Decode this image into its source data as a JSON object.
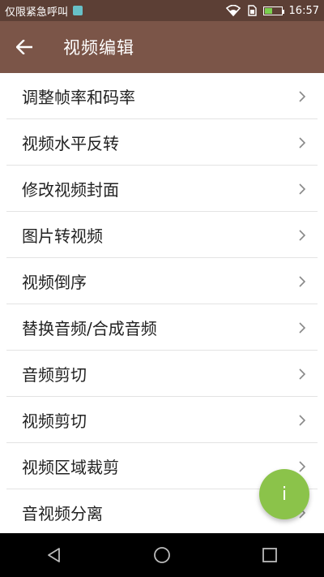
{
  "status_bar": {
    "carrier": "仅限紧急呼叫",
    "time": "16:57",
    "battery_level": 0.45,
    "icons": [
      "sim-badge-icon",
      "wifi-icon",
      "sim-card-icon",
      "battery-icon"
    ]
  },
  "app_bar": {
    "title": "视频编辑",
    "back_icon": "arrow-left-icon"
  },
  "list": {
    "items": [
      {
        "label": "调整帧率和码率"
      },
      {
        "label": "视频水平反转"
      },
      {
        "label": "修改视频封面"
      },
      {
        "label": "图片转视频"
      },
      {
        "label": "视频倒序"
      },
      {
        "label": "替换音频/合成音频"
      },
      {
        "label": "音频剪切"
      },
      {
        "label": "视频剪切"
      },
      {
        "label": "视频区域裁剪"
      },
      {
        "label": "音视频分离"
      }
    ],
    "chevron_icon": "chevron-right-icon"
  },
  "fab": {
    "label": "i",
    "color": "#8bc34a"
  },
  "nav_bar": {
    "icons": [
      "back-triangle-icon",
      "home-circle-icon",
      "recents-square-icon"
    ]
  },
  "colors": {
    "status_bar": "#5c3f35",
    "app_bar": "#7b5548",
    "background": "#ffffff"
  }
}
